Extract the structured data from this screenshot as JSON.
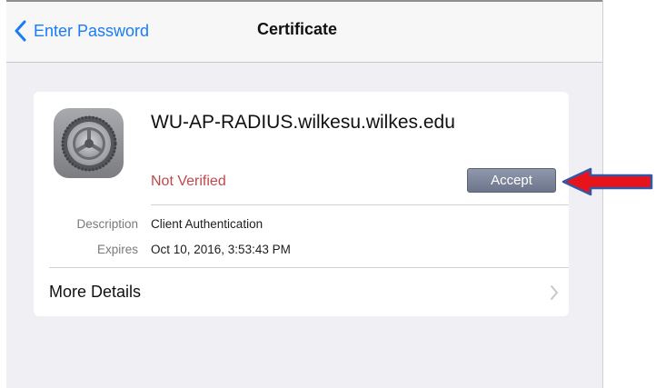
{
  "navbar": {
    "back_label": "Enter Password",
    "title": "Certificate",
    "back_icon": "chevron-left-icon"
  },
  "certificate": {
    "icon": "settings-gear-icon",
    "name": "WU-AP-RADIUS.wilkesu.wilkes.edu",
    "status": "Not Verified",
    "accept_label": "Accept",
    "details": [
      {
        "label": "Description",
        "value": "Client Authentication"
      },
      {
        "label": "Expires",
        "value": "Oct 10, 2016, 3:53:43 PM"
      }
    ],
    "more_details_label": "More Details",
    "more_icon": "chevron-right-icon"
  },
  "annotation": {
    "icon": "red-arrow-icon"
  },
  "colors": {
    "accent": "#1a7cf5",
    "status_red": "#c1484a",
    "accept_button": "#7a8397",
    "background": "#efeff4",
    "arrow_red": "#e8141b",
    "arrow_blue": "#3657a6"
  }
}
